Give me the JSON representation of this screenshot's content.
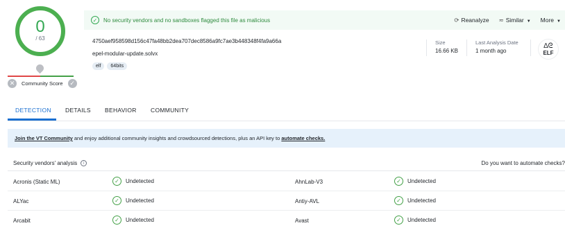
{
  "score": {
    "detections": "0",
    "total": "/ 63",
    "community_label": "Community Score",
    "negative_icon": "x-icon",
    "positive_icon": "check-icon"
  },
  "banner": {
    "message": "No security vendors and no sandboxes flagged this file as malicious",
    "reanalyze": "Reanalyze",
    "similar": "Similar",
    "more": "More"
  },
  "file": {
    "hash": "4750aef958598d156c47fa48bb2dea707dec8586a9fc7ae3b448348f4fa9a66a",
    "name": "epel-modular-update.solvx",
    "tags": [
      "elf",
      "64bits"
    ],
    "size_label": "Size",
    "size_value": "16.66 KB",
    "last_analysis_label": "Last Analysis Date",
    "last_analysis_value": "1 month ago",
    "type_badge": "ELF"
  },
  "tabs": [
    "DETECTION",
    "DETAILS",
    "BEHAVIOR",
    "COMMUNITY"
  ],
  "promo": {
    "join_link": "Join the VT Community",
    "text": " and enjoy additional community insights and crowdsourced detections, plus an API key to ",
    "automate_link": "automate checks."
  },
  "vendors": {
    "title": "Security vendors' analysis",
    "ask": "Do you want to automate checks?",
    "rows": [
      {
        "left_name": "Acronis (Static ML)",
        "left_result": "Undetected",
        "right_name": "AhnLab-V3",
        "right_result": "Undetected"
      },
      {
        "left_name": "ALYac",
        "left_result": "Undetected",
        "right_name": "Antiy-AVL",
        "right_result": "Undetected"
      },
      {
        "left_name": "Arcabit",
        "left_result": "Undetected",
        "right_name": "Avast",
        "right_result": "Undetected"
      }
    ]
  },
  "colors": {
    "clean": "#34a853",
    "accent": "#1a6fd1",
    "banner_bg": "#f2faf5",
    "promo_bg": "#e6f1fb"
  }
}
